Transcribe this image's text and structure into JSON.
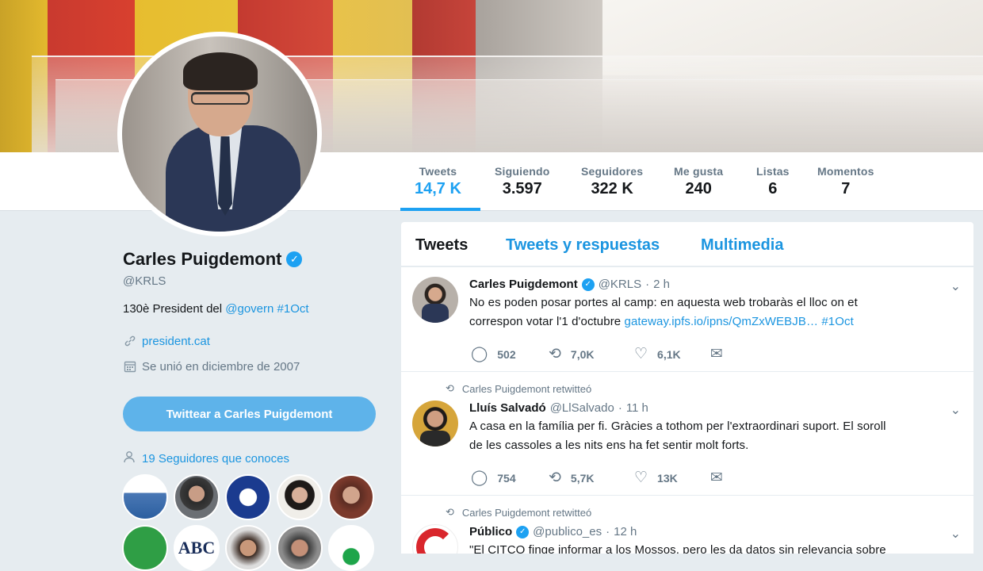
{
  "stats": [
    {
      "label": "Tweets",
      "value": "14,7 K"
    },
    {
      "label": "Siguiendo",
      "value": "3.597"
    },
    {
      "label": "Seguidores",
      "value": "322 K"
    },
    {
      "label": "Me gusta",
      "value": "240"
    },
    {
      "label": "Listas",
      "value": "6"
    },
    {
      "label": "Momentos",
      "value": "7"
    }
  ],
  "profile": {
    "name": "Carles Puigdemont",
    "handle": "@KRLS",
    "bio_prefix": "130è President del",
    "bio_mention": "@govern",
    "bio_hashtag": "#1Oct",
    "website": "president.cat",
    "joined": "Se unió en diciembre de 2007",
    "tweet_button": "Twittear a Carles Puigdemont",
    "known_followers": "19 Seguidores que conoces"
  },
  "tabs": [
    "Tweets",
    "Tweets y respuestas",
    "Multimedia"
  ],
  "colors": {
    "accent": "#1da1f2",
    "link": "#1b95e0",
    "muted": "#657786"
  },
  "tweets": [
    {
      "name": "Carles Puigdemont",
      "handle": "@KRLS",
      "time": "2 h",
      "text_a": "No es poden posar portes al camp: en aquesta web trobaràs el lloc on et",
      "text_b": "correspon votar l'1 d'octubre",
      "link": "gateway.ipfs.io/ipns/QmZxWEBJB…",
      "hashtag": "#1Oct",
      "replies": "502",
      "retweets": "7,0K",
      "likes": "6,1K"
    },
    {
      "retweet_context": "Carles Puigdemont retwitteó",
      "name": "Lluís Salvadó",
      "handle": "@LlSalvado",
      "time": "11 h",
      "text_a": "A casa en la família per fi. Gràcies a tothom per l'extraordinari suport. El soroll",
      "text_b": "de les cassoles a les nits ens ha fet sentir molt forts.",
      "replies": "754",
      "retweets": "5,7K",
      "likes": "13K"
    },
    {
      "retweet_context": "Carles Puigdemont retwitteó",
      "name": "Público",
      "handle": "@publico_es",
      "time": "12 h",
      "text_a": "\"El CITCO finge informar a los Mossos, pero les da datos sin relevancia sobre"
    }
  ],
  "icons": [
    "verified-icon",
    "link-icon",
    "calendar-icon",
    "person-icon",
    "reply-icon",
    "retweet-icon",
    "like-icon",
    "message-icon",
    "chevron-down-icon"
  ],
  "mini_text": {
    "abc": "ABC"
  }
}
